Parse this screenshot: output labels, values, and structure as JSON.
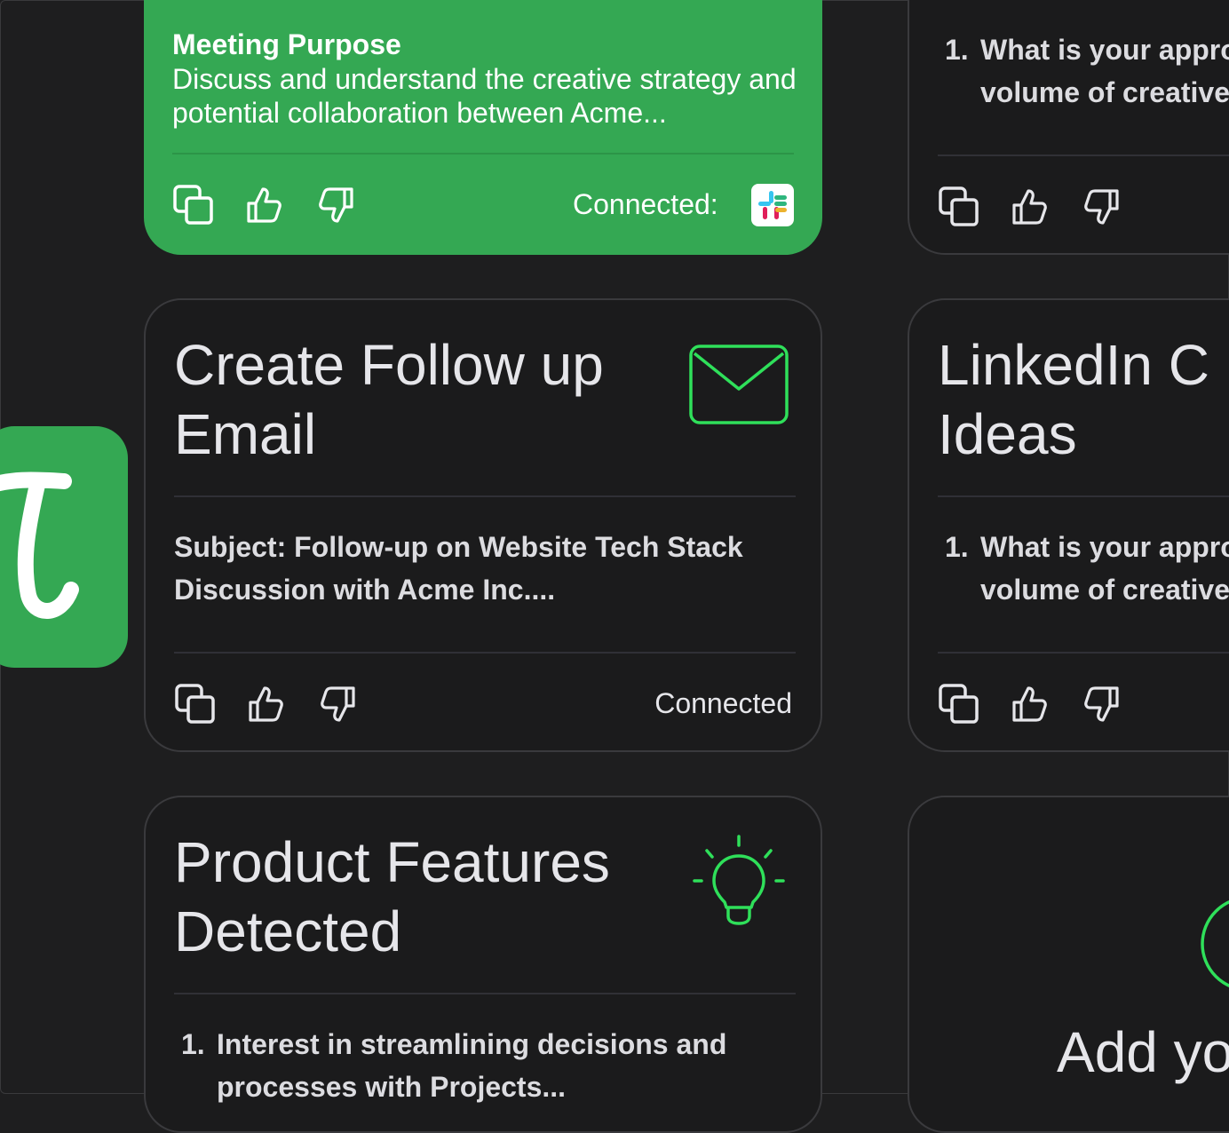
{
  "meeting_card": {
    "label": "Meeting Purpose",
    "text": "Discuss and understand the creative strategy and potential collaboration between Acme...",
    "connected_label": "Connected:"
  },
  "top_right_card": {
    "item_num": "1.",
    "item_text_line1": "What is your appro",
    "item_text_line2": "volume of creative"
  },
  "followup_card": {
    "title": "Create Follow up Email",
    "subject_line1": "Subject: Follow-up on Website Tech Stack",
    "subject_line2": "Discussion with Acme Inc....",
    "status": "Connected"
  },
  "linkedin_card": {
    "title_line1": "LinkedIn C",
    "title_line2": "Ideas",
    "item_num": "1.",
    "item_text_line1": "What is your appro",
    "item_text_line2": "volume of creative"
  },
  "features_card": {
    "title_line1": "Product Features",
    "title_line2": "Detected",
    "item_num": "1.",
    "item_text_line1": "Interest in streamlining decisions and",
    "item_text_line2": "processes with Projects..."
  },
  "add_card": {
    "text": "Add yo"
  },
  "colors": {
    "accent_green": "#34a853",
    "icon_green": "#2fe05a",
    "background": "#1e1e1f"
  }
}
